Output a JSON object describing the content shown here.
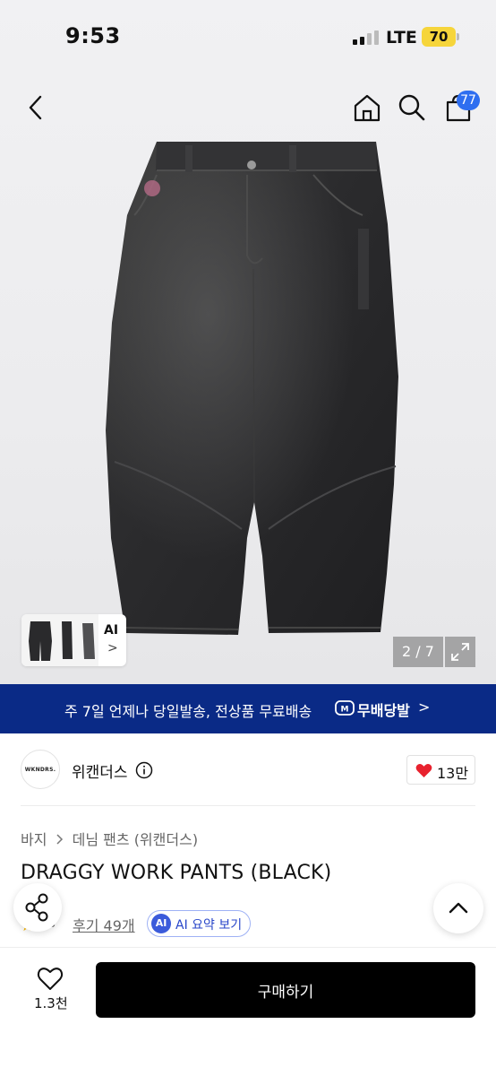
{
  "status_bar": {
    "time": "9:53",
    "network": "LTE",
    "battery": "70"
  },
  "nav": {
    "cart_count": "77"
  },
  "gallery": {
    "ai_label": "AI",
    "ai_chevron": ">",
    "pager": "2 / 7"
  },
  "banner": {
    "text": "주 7일 언제나 당일발송, 전상품 무료배송",
    "brand": "무배당발",
    "chevron": ">"
  },
  "brand": {
    "logo_text": "WKNDRS.",
    "name": "위캔더스",
    "likes": "13만"
  },
  "breadcrumb": {
    "items": [
      "바지",
      "데님 팬츠 (위캔더스)"
    ]
  },
  "product": {
    "title": "DRAGGY WORK PANTS (BLACK)",
    "star": "★",
    "rating": ".8",
    "reviews": "후기 49개"
  },
  "ai_summary": {
    "badge": "AI",
    "label": "AI 요약 보기"
  },
  "bottom": {
    "favorites": "1.3천",
    "buy_label": "구매하기"
  },
  "colors": {
    "banner_bg": "#0a2a86",
    "badge_blue": "#2e6ef0",
    "heart_red": "#e8222e",
    "battery": "#f6d53b"
  }
}
